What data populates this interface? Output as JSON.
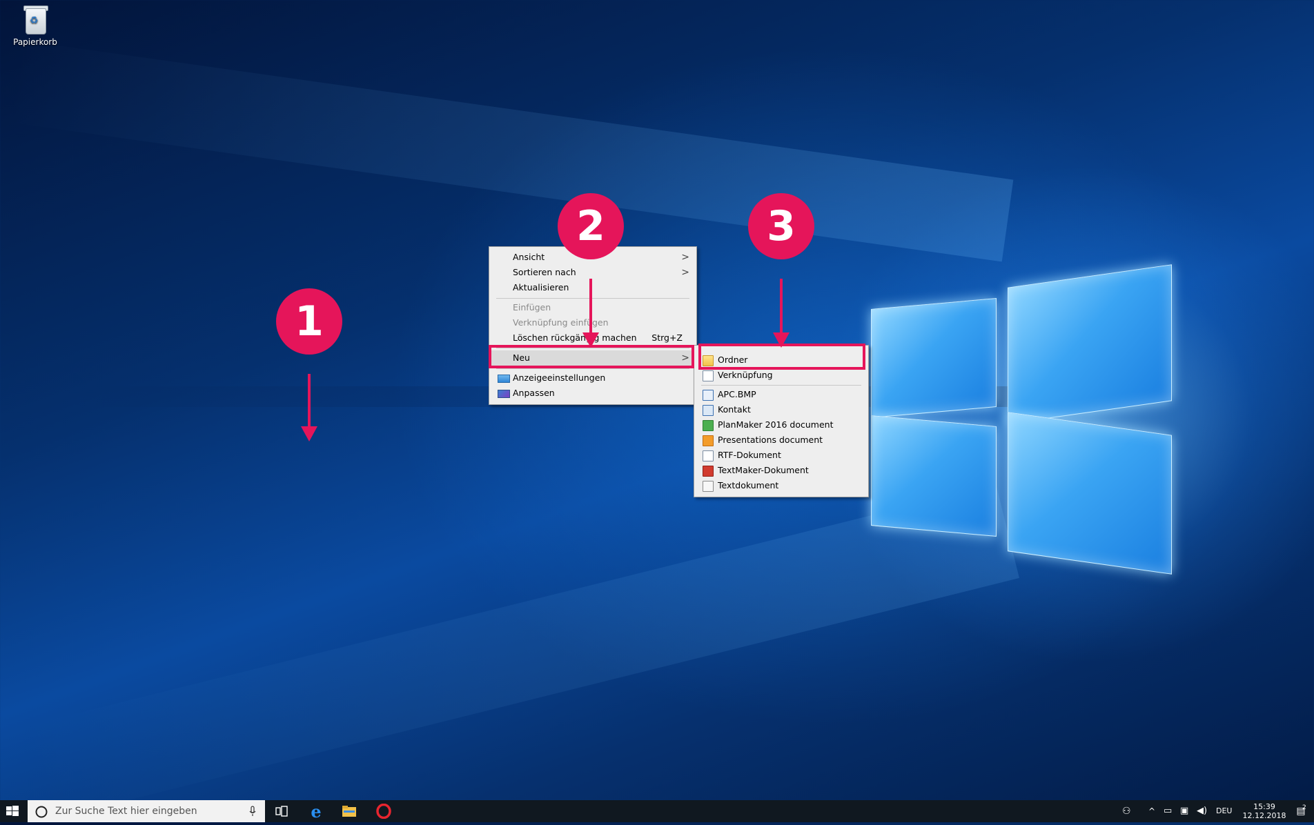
{
  "desktop": {
    "recycle_bin_label": "Papierkorb"
  },
  "context_menu": {
    "items": [
      {
        "label": "Ansicht",
        "has_submenu": true
      },
      {
        "label": "Sortieren nach",
        "has_submenu": true
      },
      {
        "label": "Aktualisieren"
      },
      {
        "label": "Einfügen",
        "disabled": true
      },
      {
        "label": "Verknüpfung einfügen",
        "disabled": true
      },
      {
        "label": "Löschen rückgängig machen",
        "shortcut": "Strg+Z"
      },
      {
        "label": "Neu",
        "has_submenu": true,
        "highlighted": true
      },
      {
        "label": "Anzeigeeinstellungen",
        "icon": "display-settings-icon"
      },
      {
        "label": "Anpassen",
        "icon": "personalize-icon"
      }
    ],
    "submenu_arrow": ">"
  },
  "new_submenu": {
    "items": [
      {
        "label": "Ordner",
        "icon": "folder-icon"
      },
      {
        "label": "Verknüpfung",
        "icon": "shortcut-icon"
      },
      {
        "label": "APC.BMP",
        "icon": "bitmap-icon"
      },
      {
        "label": "Kontakt",
        "icon": "contact-icon"
      },
      {
        "label": "PlanMaker 2016 document",
        "icon": "planmaker-icon"
      },
      {
        "label": "Presentations document",
        "icon": "presentations-icon"
      },
      {
        "label": "RTF-Dokument",
        "icon": "rtf-icon"
      },
      {
        "label": "TextMaker-Dokument",
        "icon": "textmaker-icon"
      },
      {
        "label": "Textdokument",
        "icon": "text-document-icon"
      }
    ]
  },
  "annotations": {
    "step1": "1",
    "step2": "2",
    "step3": "3",
    "color": "#e5155a"
  },
  "taskbar": {
    "search_placeholder": "Zur Suche Text hier eingeben",
    "language": "DEU",
    "time": "15:39",
    "date": "12.12.2018",
    "notification_count": "2"
  },
  "colors": {
    "menu_bg": "#eeeeee",
    "taskbar_bg": "#101820",
    "accent_pink": "#e5155a"
  }
}
